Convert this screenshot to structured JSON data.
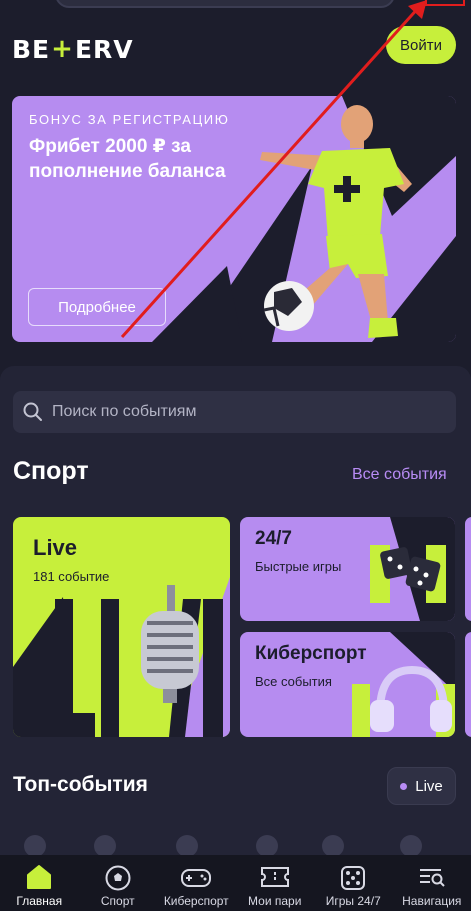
{
  "header": {
    "logo_left": "BE",
    "logo_plus": "+",
    "logo_right": "ERV",
    "login_label": "Войти"
  },
  "banner": {
    "subtitle": "БОНУС ЗА РЕГИСТРАЦИЮ",
    "title": "Фрибет 2000 ₽ за пополнение баланса",
    "button": "Подробнее"
  },
  "search": {
    "placeholder": "Поиск по событиям"
  },
  "sport": {
    "title": "Спорт",
    "all_events": "Все события",
    "cards": [
      {
        "title": "Live",
        "subtitle": "181 событие"
      },
      {
        "title": "24/7",
        "subtitle": "Быстрые игры"
      },
      {
        "title": "Киберспорт",
        "subtitle": "Все события"
      }
    ]
  },
  "top_events": {
    "title": "Топ-события",
    "live_chip": "Live"
  },
  "bottom_nav": [
    {
      "label": "Главная",
      "icon": "home-icon"
    },
    {
      "label": "Спорт",
      "icon": "soccer-ball-icon"
    },
    {
      "label": "Киберспорт",
      "icon": "gamepad-icon"
    },
    {
      "label": "Мои пари",
      "icon": "ticket-icon"
    },
    {
      "label": "Игры 24/7",
      "icon": "dice-icon"
    },
    {
      "label": "Навигация",
      "icon": "menu-search-icon"
    }
  ],
  "colors": {
    "background": "#1c1d2c",
    "accent_lime": "#c7ef3b",
    "accent_purple": "#b68cf0",
    "annotation_red": "#e11d1d"
  }
}
